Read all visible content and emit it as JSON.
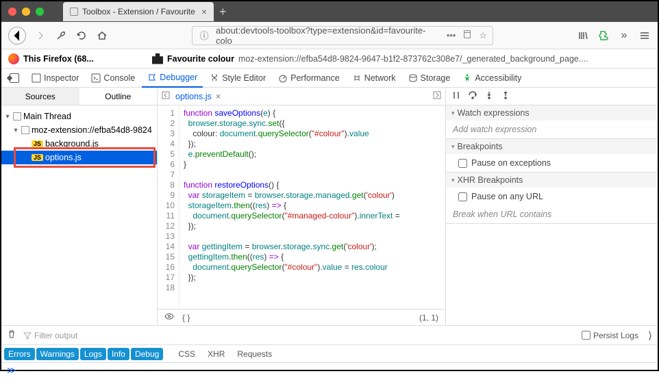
{
  "window": {
    "tab_title": "Toolbox - Extension / Favourite"
  },
  "url": "about:devtools-toolbox?type=extension&id=favourite-colo",
  "context": {
    "left": "This Firefox (68...",
    "ext_name": "Favourite colour",
    "ext_url": "moz-extension://efba54d8-9824-9647-b1f2-873762c308e7/_generated_background_page...."
  },
  "panels": [
    "Inspector",
    "Console",
    "Debugger",
    "Style Editor",
    "Performance",
    "Network",
    "Storage",
    "Accessibility"
  ],
  "active_panel": "Debugger",
  "sidebar": {
    "tabs": [
      "Sources",
      "Outline"
    ],
    "active": "Sources",
    "thread": "Main Thread",
    "origin": "moz-extension://efba54d8-9824",
    "files": [
      "background.js",
      "options.js"
    ],
    "selected": "options.js"
  },
  "editor": {
    "file": "options.js",
    "lines": 18,
    "cursor": "(1, 1)"
  },
  "right": {
    "watch": {
      "title": "Watch expressions",
      "placeholder": "Add watch expression"
    },
    "bp": {
      "title": "Breakpoints",
      "opt1": "Pause on exceptions"
    },
    "xhr": {
      "title": "XHR Breakpoints",
      "opt1": "Pause on any URL",
      "hint": "Break when URL contains"
    }
  },
  "console": {
    "filter_placeholder": "Filter output",
    "persist": "Persist Logs",
    "pills": [
      "Errors",
      "Warnings",
      "Logs",
      "Info",
      "Debug"
    ],
    "plain": [
      "CSS",
      "XHR",
      "Requests"
    ],
    "prompt": "≫"
  },
  "chart_data": null
}
